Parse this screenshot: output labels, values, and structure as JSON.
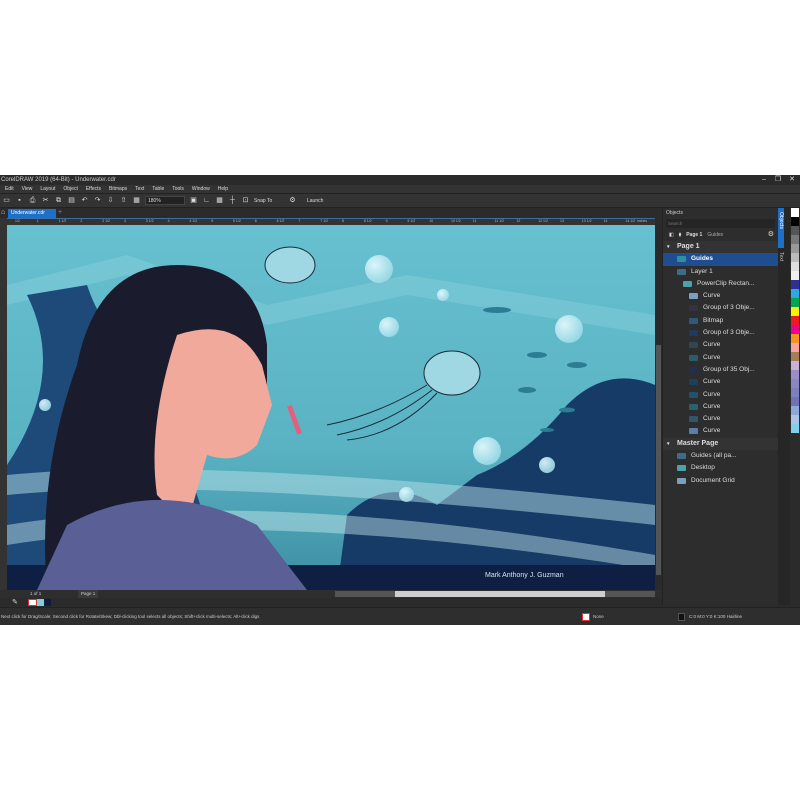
{
  "window": {
    "title": "CorelDRAW 2019 (64-Bit) - Underwater.cdr",
    "minimize": "–",
    "restore": "❐",
    "close": "✕"
  },
  "menu": [
    "Edit",
    "View",
    "Layout",
    "Object",
    "Effects",
    "Bitmaps",
    "Text",
    "Table",
    "Tools",
    "Window",
    "Help"
  ],
  "toolbar": {
    "zoom": "180%",
    "snap": "Snap To",
    "launch": "Launch"
  },
  "doc_tab": "Underwater.cdr",
  "ruler": {
    "labels": [
      "1/2",
      "1",
      "1 1/2",
      "2",
      "2 1/2",
      "3",
      "3 1/2",
      "4",
      "4 1/2",
      "5",
      "5 1/2",
      "6",
      "6 1/2",
      "7",
      "7 1/2",
      "8",
      "8 1/2",
      "9",
      "9 1/2",
      "10",
      "10 1/2",
      "11",
      "11 1/2",
      "12",
      "12 1/2",
      "13",
      "13 1/2",
      "14",
      "14 1/2"
    ],
    "unit": "inches"
  },
  "artwork": {
    "signature": "Mark Anthony J. Guzman"
  },
  "pagebar": {
    "counter": "1 of 1",
    "page": "Page 1"
  },
  "objects_panel": {
    "title": "Objects",
    "search": "Search",
    "page_label": "Page 1",
    "guides_label": "Guides",
    "rows": [
      {
        "label": "Page 1",
        "type": "header"
      },
      {
        "label": "Guides",
        "type": "selected"
      },
      {
        "label": "Layer 1",
        "indent": 1
      },
      {
        "label": "PowerClip Rectan...",
        "indent": 2
      },
      {
        "label": "Curve",
        "indent": 3
      },
      {
        "label": "Group of 3 Obje...",
        "indent": 3
      },
      {
        "label": "Bitmap",
        "indent": 3
      },
      {
        "label": "Group of 3 Obje...",
        "indent": 3
      },
      {
        "label": "Curve",
        "indent": 3
      },
      {
        "label": "Curve",
        "indent": 3
      },
      {
        "label": "Group of 35 Obj...",
        "indent": 3
      },
      {
        "label": "Curve",
        "indent": 3
      },
      {
        "label": "Curve",
        "indent": 3
      },
      {
        "label": "Curve",
        "indent": 3
      },
      {
        "label": "Curve",
        "indent": 3
      },
      {
        "label": "Curve",
        "indent": 3
      },
      {
        "label": "Master Page",
        "type": "header"
      },
      {
        "label": "Guides (all pa...",
        "indent": 1
      },
      {
        "label": "Desktop",
        "indent": 1
      },
      {
        "label": "Document Grid",
        "indent": 1
      }
    ]
  },
  "side_tabs": [
    "Objects",
    "Text"
  ],
  "palette": [
    "#ffffff",
    "#000000",
    "#555555",
    "#777777",
    "#999999",
    "#bbbbbb",
    "#dddddd",
    "#f0f0f0",
    "#2e3192",
    "#29abe2",
    "#00a651",
    "#fff200",
    "#ed1c24",
    "#ec008c",
    "#f7941d",
    "#f9a3a3",
    "#a67c52",
    "#c7b2d6",
    "#9a8ec6",
    "#8a86c2",
    "#7b7fc0",
    "#6f73b6",
    "#8fa6d8",
    "#a9c4e6",
    "#7fd0e8"
  ],
  "status": {
    "hint": "Next click for Drag/Scale; Second click for Rotate/Skew; Dbl-clicking tool selects all objects; Shift+click multi-selects; Alt+click digs",
    "fill": "None",
    "outline": "C:0 M:0 Y:0 K:100  Hairline"
  }
}
